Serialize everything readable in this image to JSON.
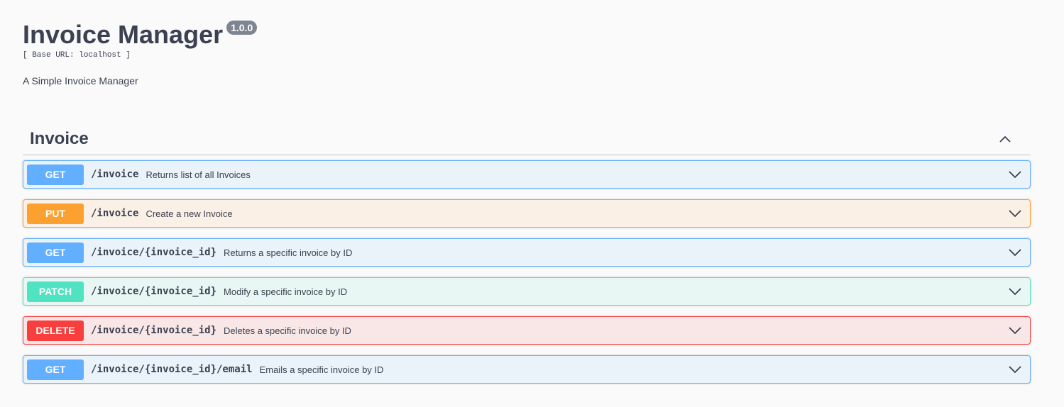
{
  "info": {
    "title": "Invoice Manager",
    "version": "1.0.0",
    "base_url": "[ Base URL: localhost ]",
    "description": "A Simple Invoice Manager"
  },
  "tag": {
    "name": "Invoice",
    "collapse_icon": "chevron-up-icon"
  },
  "colors": {
    "get": "#61affe",
    "put": "#fca130",
    "patch": "#50e3c2",
    "delete": "#f93e3e"
  },
  "operations": [
    {
      "method": "GET",
      "path": "/invoice",
      "summary": "Returns list of all Invoices"
    },
    {
      "method": "PUT",
      "path": "/invoice",
      "summary": "Create a new Invoice"
    },
    {
      "method": "GET",
      "path": "/invoice/{invoice_id}",
      "summary": "Returns a specific invoice by ID"
    },
    {
      "method": "PATCH",
      "path": "/invoice/{invoice_id}",
      "summary": "Modify a specific invoice by ID"
    },
    {
      "method": "DELETE",
      "path": "/invoice/{invoice_id}",
      "summary": "Deletes a specific invoice by ID"
    },
    {
      "method": "GET",
      "path": "/invoice/{invoice_id}/email",
      "summary": "Emails a specific invoice by ID"
    }
  ]
}
